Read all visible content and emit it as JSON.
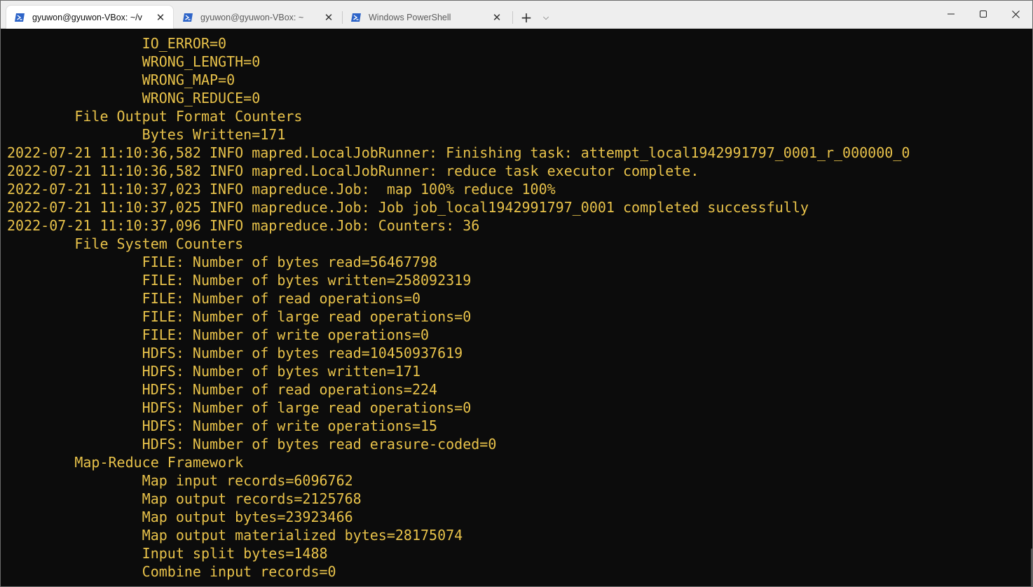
{
  "tabs": [
    {
      "label": "gyuwon@gyuwon-VBox: ~/v",
      "active": true,
      "icon": "powershell-icon"
    },
    {
      "label": "gyuwon@gyuwon-VBox: ~",
      "active": false,
      "icon": "powershell-icon"
    },
    {
      "label": "Windows PowerShell",
      "active": false,
      "icon": "powershell-icon"
    }
  ],
  "tab_close_glyph": "✕",
  "new_tab_glyph": "+",
  "dropdown_glyph": "⌵",
  "colors": {
    "terminal_bg": "#0c0c0c",
    "terminal_text": "#e8c24a",
    "powershell_blue": "#2d64c8"
  },
  "terminal": {
    "lines": [
      "                IO_ERROR=0",
      "                WRONG_LENGTH=0",
      "                WRONG_MAP=0",
      "                WRONG_REDUCE=0",
      "        File Output Format Counters",
      "                Bytes Written=171",
      "2022-07-21 11:10:36,582 INFO mapred.LocalJobRunner: Finishing task: attempt_local1942991797_0001_r_000000_0",
      "2022-07-21 11:10:36,582 INFO mapred.LocalJobRunner: reduce task executor complete.",
      "2022-07-21 11:10:37,023 INFO mapreduce.Job:  map 100% reduce 100%",
      "2022-07-21 11:10:37,025 INFO mapreduce.Job: Job job_local1942991797_0001 completed successfully",
      "2022-07-21 11:10:37,096 INFO mapreduce.Job: Counters: 36",
      "        File System Counters",
      "                FILE: Number of bytes read=56467798",
      "                FILE: Number of bytes written=258092319",
      "                FILE: Number of read operations=0",
      "                FILE: Number of large read operations=0",
      "                FILE: Number of write operations=0",
      "                HDFS: Number of bytes read=10450937619",
      "                HDFS: Number of bytes written=171",
      "                HDFS: Number of read operations=224",
      "                HDFS: Number of large read operations=0",
      "                HDFS: Number of write operations=15",
      "                HDFS: Number of bytes read erasure-coded=0",
      "        Map-Reduce Framework",
      "                Map input records=6096762",
      "                Map output records=2125768",
      "                Map output bytes=23923466",
      "                Map output materialized bytes=28175074",
      "                Input split bytes=1488",
      "                Combine input records=0"
    ]
  }
}
